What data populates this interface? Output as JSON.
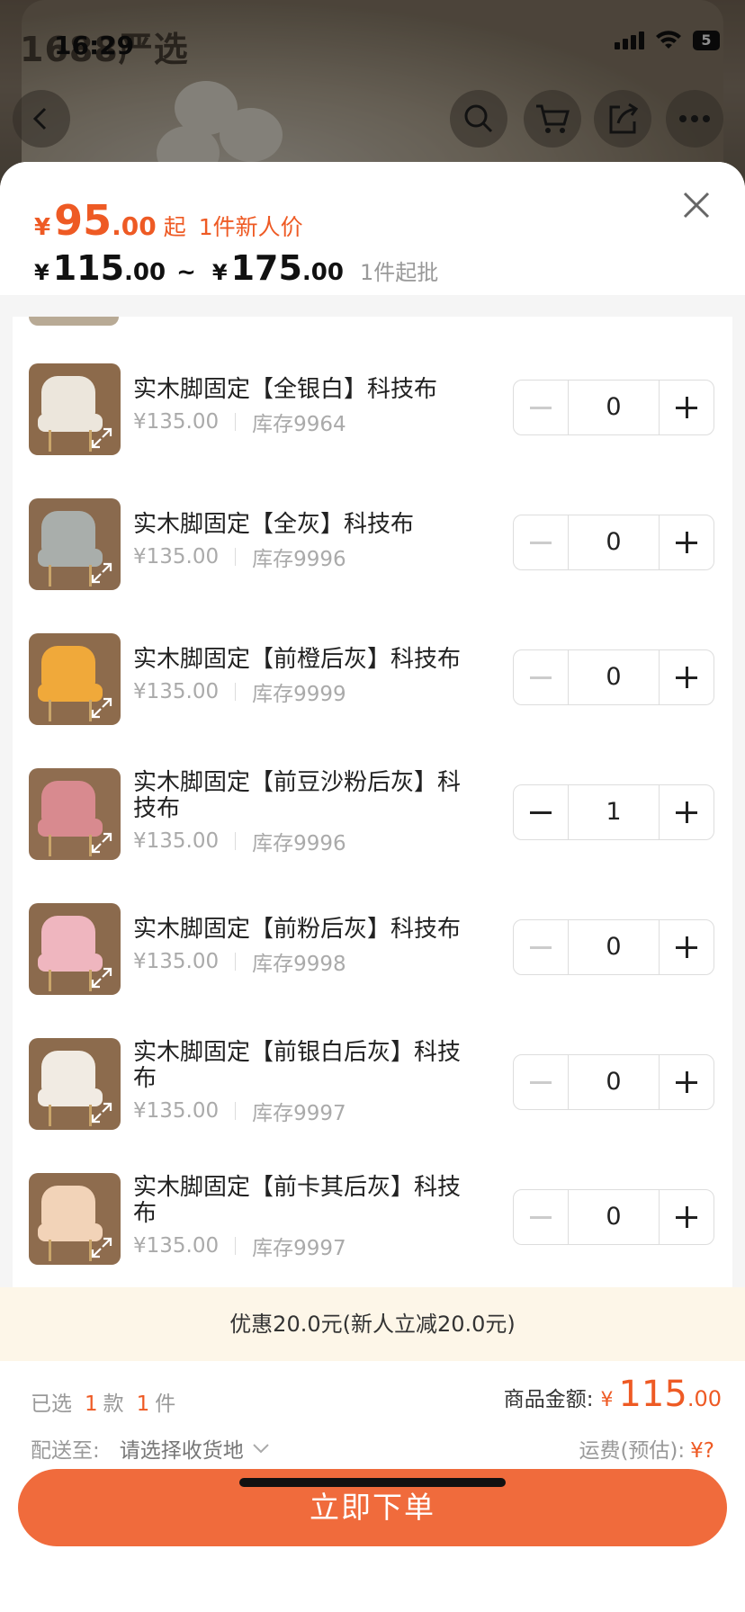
{
  "background": {
    "app_title": "1688严选",
    "status_time": "16:29",
    "battery": "5"
  },
  "header": {
    "newuser_price_yen": "¥",
    "newuser_price_int": "95",
    "newuser_price_dec": ".00",
    "newuser_price_suffix": "起",
    "newuser_tag": "1件新人价",
    "range_yen_from": "¥",
    "range_from_int": "115",
    "range_from_dec": ".00",
    "range_sep": "~",
    "range_yen_to": "¥",
    "range_to_int": "175",
    "range_to_dec": ".00",
    "moq": "1件起批"
  },
  "items": [
    {
      "name": "实木脚固定【全银白】科技布",
      "price": "¥135.00",
      "stock": "库存9964",
      "qty": "0",
      "color": "#ece6dc",
      "bg": "#8c6a4b"
    },
    {
      "name": "实木脚固定【全灰】科技布",
      "price": "¥135.00",
      "stock": "库存9996",
      "qty": "0",
      "color": "#a9aeab",
      "bg": "#8a6a4e"
    },
    {
      "name": "实木脚固定【前橙后灰】科技布",
      "price": "¥135.00",
      "stock": "库存9999",
      "qty": "0",
      "color": "#f0a93a",
      "bg": "#8d6b4c"
    },
    {
      "name": "实木脚固定【前豆沙粉后灰】科技布",
      "price": "¥135.00",
      "stock": "库存9996",
      "qty": "1",
      "color": "#d88a8f",
      "bg": "#8f6d50"
    },
    {
      "name": "实木脚固定【前粉后灰】科技布",
      "price": "¥135.00",
      "stock": "库存9998",
      "qty": "0",
      "color": "#efb6bf",
      "bg": "#8b6a4d"
    },
    {
      "name": "实木脚固定【前银白后灰】科技布",
      "price": "¥135.00",
      "stock": "库存9997",
      "qty": "0",
      "color": "#f1ebe3",
      "bg": "#8c6b4d"
    },
    {
      "name": "实木脚固定【前卡其后灰】科技布",
      "price": "¥135.00",
      "stock": "库存9997",
      "qty": "0",
      "color": "#f2d3b8",
      "bg": "#8e6c4e"
    }
  ],
  "promo": "优惠20.0元(新人立减20.0元)",
  "footer": {
    "selected_prefix": "已选",
    "selected_models": "1",
    "selected_models_unit": "款",
    "selected_pieces": "1",
    "selected_pieces_unit": "件",
    "ship_label": "配送至:",
    "ship_placeholder": "请选择收货地",
    "amount_label": "商品金额:",
    "amount_yen": "¥",
    "amount_int": "115",
    "amount_dec": ".00",
    "freight_label": "运费(预估):",
    "freight_value": "¥?",
    "order_button": "立即下单"
  }
}
